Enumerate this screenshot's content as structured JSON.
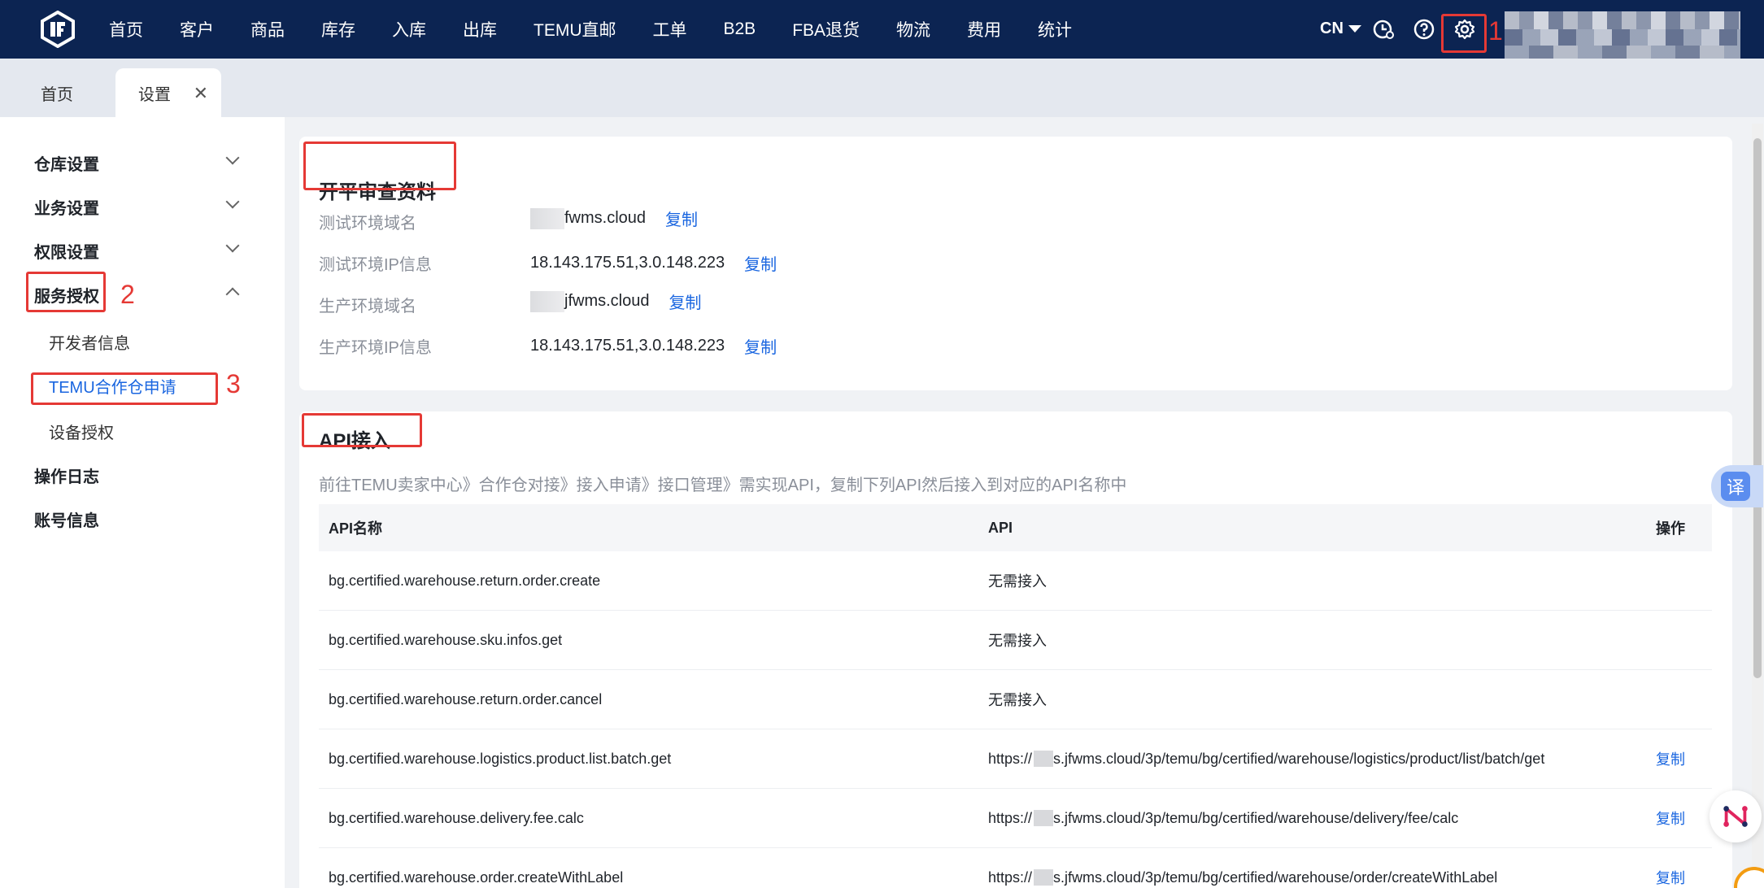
{
  "nav": {
    "items": [
      "首页",
      "客户",
      "商品",
      "库存",
      "入库",
      "出库",
      "TEMU直邮",
      "工单",
      "B2B",
      "FBA退货",
      "物流",
      "费用",
      "统计"
    ],
    "lang": "CN"
  },
  "annotations": [
    "1",
    "2",
    "3"
  ],
  "tabs": {
    "home": "首页",
    "settings": "设置",
    "close": "✕"
  },
  "sidebar": {
    "groups": [
      "仓库设置",
      "业务设置",
      "权限设置",
      "服务授权"
    ],
    "sub_items": [
      "开发者信息",
      "TEMU合作仓申请",
      "设备授权"
    ],
    "groups_bottom": [
      "操作日志",
      "账号信息"
    ]
  },
  "review": {
    "title": "开平审查资料",
    "rows": [
      {
        "label": "测试环境域名",
        "value": "fwms.cloud",
        "copy": "复制"
      },
      {
        "label": "测试环境IP信息",
        "value": "18.143.175.51,3.0.148.223",
        "copy": "复制"
      },
      {
        "label": "生产环境域名",
        "value": "jfwms.cloud",
        "copy": "复制"
      },
      {
        "label": "生产环境IP信息",
        "value": "18.143.175.51,3.0.148.223",
        "copy": "复制"
      }
    ]
  },
  "api": {
    "title": "API接入",
    "desc": "前往TEMU卖家中心》合作仓对接》接入申请》接口管理》需实现API，复制下列API然后接入到对应的API名称中",
    "headers": [
      "API名称",
      "API",
      "操作"
    ],
    "url_prefix": "https://",
    "rows": [
      {
        "name": "bg.certified.warehouse.return.order.create",
        "api": "无需接入",
        "action": ""
      },
      {
        "name": "bg.certified.warehouse.sku.infos.get",
        "api": "无需接入",
        "action": ""
      },
      {
        "name": "bg.certified.warehouse.return.order.cancel",
        "api": "无需接入",
        "action": ""
      },
      {
        "name": "bg.certified.warehouse.logistics.product.list.batch.get",
        "api": "s.jfwms.cloud/3p/temu/bg/certified/warehouse/logistics/product/list/batch/get",
        "action": "复制"
      },
      {
        "name": "bg.certified.warehouse.delivery.fee.calc",
        "api": "s.jfwms.cloud/3p/temu/bg/certified/warehouse/delivery/fee/calc",
        "action": "复制"
      },
      {
        "name": "bg.certified.warehouse.order.createWithLabel",
        "api": "s.jfwms.cloud/3p/temu/bg/certified/warehouse/order/createWithLabel",
        "action": "复制"
      }
    ]
  },
  "float": {
    "translate": "译"
  },
  "colors": {
    "nav_bg": "#0c2452",
    "accent": "#1a66e0",
    "annotation": "#e53935"
  }
}
